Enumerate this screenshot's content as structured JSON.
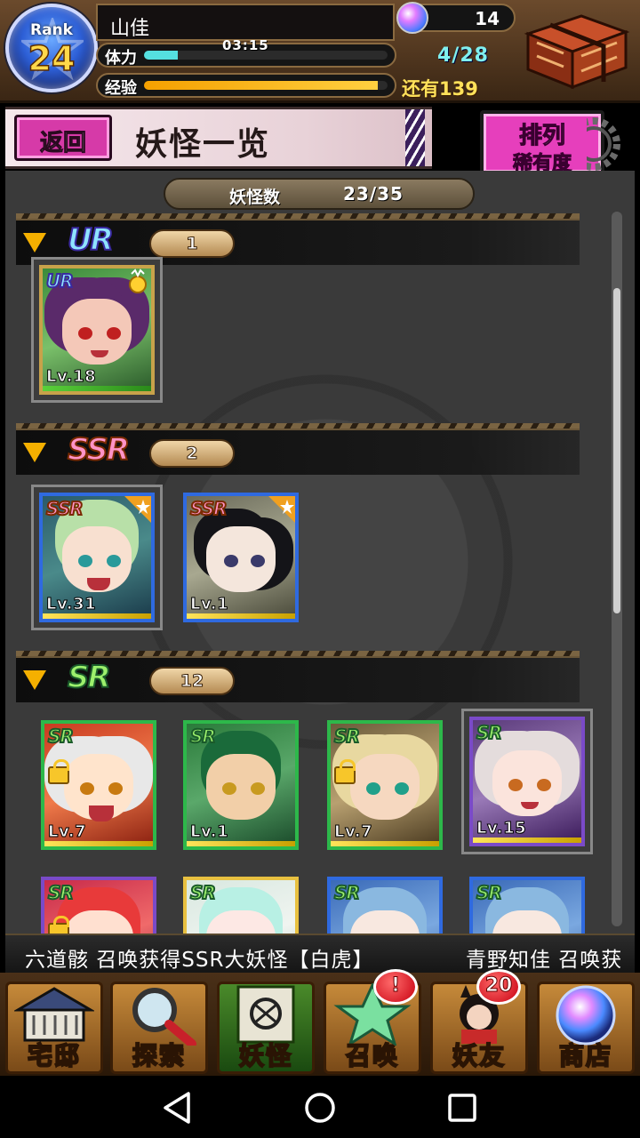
{
  "player": {
    "rank_label": "Rank",
    "rank": "24",
    "name": "山佳",
    "stamina_label": "体力",
    "stamina_timer": "03:15",
    "stamina_value": "4/28",
    "stamina_fraction": 0.14,
    "exp_label": "经验",
    "exp_remaining": "还有139",
    "exp_fraction": 0.96,
    "gems": "14"
  },
  "header": {
    "back_label": "返回",
    "title": "妖怪一览",
    "sort_title": "排列",
    "sort_value": "稀有度"
  },
  "summary": {
    "count_label": "妖怪数",
    "count_value": "23/35"
  },
  "sections": [
    {
      "rarity": "UR",
      "count": "1"
    },
    {
      "rarity": "SSR",
      "count": "2"
    },
    {
      "rarity": "SR",
      "count": "12"
    }
  ],
  "cards": {
    "ur": [
      {
        "tag": "UR",
        "level": "Lv.18"
      }
    ],
    "ssr": [
      {
        "tag": "SSR",
        "level": "Lv.31"
      },
      {
        "tag": "SSR",
        "level": "Lv.1"
      }
    ],
    "sr_row1": [
      {
        "tag": "SR",
        "level": "Lv.7"
      },
      {
        "tag": "SR",
        "level": "Lv.1"
      },
      {
        "tag": "SR",
        "level": "Lv.7"
      },
      {
        "tag": "SR",
        "level": "Lv.15"
      }
    ],
    "sr_row2": [
      {
        "tag": "SR"
      },
      {
        "tag": "SR"
      },
      {
        "tag": "SR"
      },
      {
        "tag": "SR"
      }
    ]
  },
  "ticker": {
    "message_a": "六道骸 召唤获得SSR大妖怪【白虎】",
    "message_b": "青野知佳 召唤获"
  },
  "nav": [
    {
      "label": "宅邸",
      "icon": "mansion-icon"
    },
    {
      "label": "探索",
      "icon": "magnifier-icon"
    },
    {
      "label": "妖怪",
      "icon": "scroll-icon"
    },
    {
      "label": "召唤",
      "icon": "pentagram-icon",
      "badge": "!"
    },
    {
      "label": "妖友",
      "icon": "friend-icon",
      "badge": "20"
    },
    {
      "label": "商店",
      "icon": "orb-icon"
    }
  ],
  "colors": {
    "accent_pink": "#e63fbc",
    "stamina": "#55e0e0",
    "exp": "#f5a000",
    "ur": "#8fe4ff",
    "ssr": "#ff93c8",
    "sr": "#9cf06c"
  }
}
